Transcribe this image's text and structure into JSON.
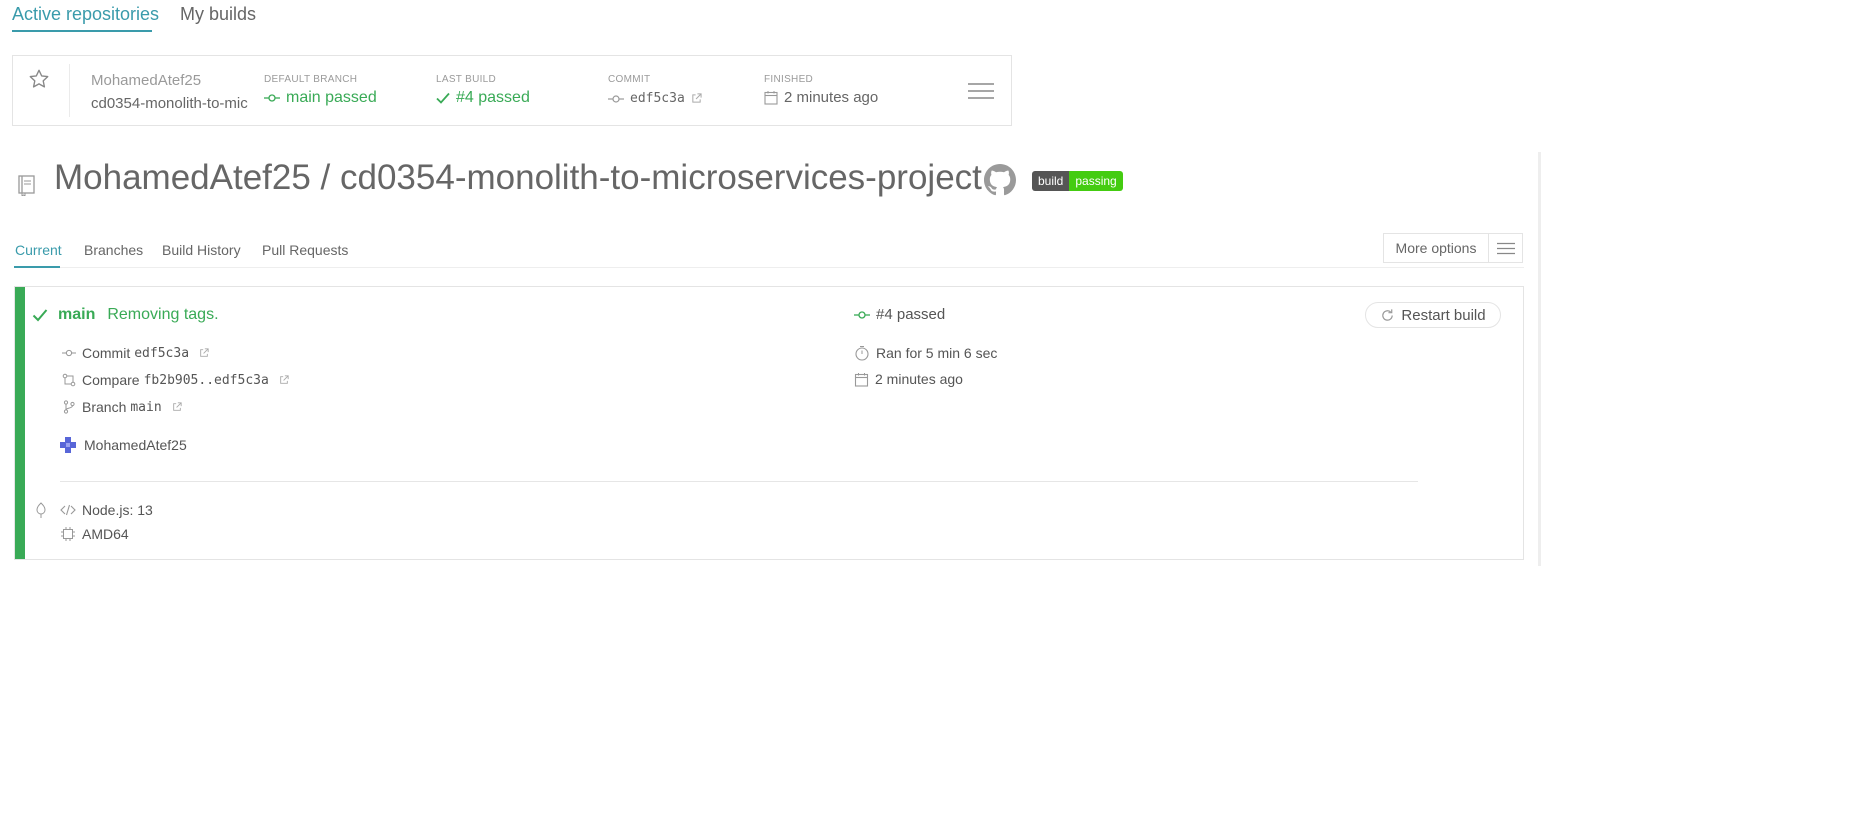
{
  "top_tabs": {
    "active": "Active repositories",
    "my_builds": "My builds"
  },
  "repo_card": {
    "owner": "MohamedAtef25",
    "repo": "cd0354-monolith-to-mic",
    "default_branch_label": "DEFAULT BRANCH",
    "default_branch_value": "main passed",
    "last_build_label": "LAST BUILD",
    "last_build_value": "#4 passed",
    "commit_label": "COMMIT",
    "commit_value": "edf5c3a",
    "finished_label": "FINISHED",
    "finished_value": "2 minutes ago"
  },
  "heading": {
    "title": "MohamedAtef25 / cd0354-monolith-to-microservices-project",
    "badge_left": "build",
    "badge_right": "passing"
  },
  "subtabs": {
    "current": "Current",
    "branches": "Branches",
    "history": "Build History",
    "pulls": "Pull Requests"
  },
  "more_options": "More options",
  "build": {
    "branch": "main",
    "message": "Removing tags.",
    "status": "#4 passed",
    "restart_label": "Restart build",
    "commit_prefix": "Commit",
    "commit": "edf5c3a",
    "compare_prefix": "Compare",
    "compare": "fb2b905..edf5c3a",
    "branch_prefix": "Branch",
    "branch_value": "main",
    "ran_for": "Ran for 5 min 6 sec",
    "time_ago": "2 minutes ago",
    "author": "MohamedAtef25",
    "language": "Node.js: 13",
    "arch": "AMD64"
  },
  "colors": {
    "accent": "#3a9bab",
    "passed": "#39aa56",
    "badge_green": "#44cc11"
  }
}
